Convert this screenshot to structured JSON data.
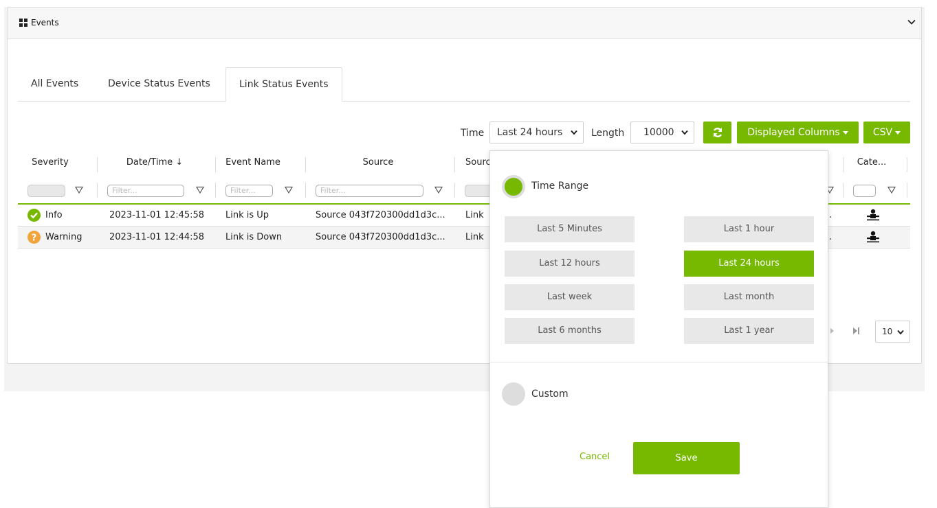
{
  "panel": {
    "title": "Events"
  },
  "tabs": [
    {
      "label": "All Events"
    },
    {
      "label": "Device Status Events"
    },
    {
      "label": "Link Status Events"
    }
  ],
  "toolbar": {
    "time_label": "Time",
    "time_value": "Last 24 hours",
    "length_label": "Length",
    "length_value": "10000",
    "displayed_columns_label": "Displayed Columns",
    "csv_label": "CSV"
  },
  "table": {
    "columns": [
      "Severity",
      "Date/Time ↓",
      "Event Name",
      "Source",
      "Sourc",
      "Cate..."
    ],
    "filter_placeholder": "Filter...",
    "rows": [
      {
        "severity": "Info",
        "datetime": "2023-11-01 12:45:58",
        "event_name": "Link is Up",
        "source": "Source 043f720300dd1d3c...",
        "source2": "Link",
        "trunc": "."
      },
      {
        "severity": "Warning",
        "datetime": "2023-11-01 12:44:58",
        "event_name": "Link is Down",
        "source": "Source 043f720300dd1d3c...",
        "source2": "Link",
        "trunc": "."
      }
    ],
    "page_size": "10"
  },
  "popup": {
    "time_range_label": "Time Range",
    "ranges": [
      {
        "label": "Last 5 Minutes"
      },
      {
        "label": "Last 1 hour"
      },
      {
        "label": "Last 12 hours"
      },
      {
        "label": "Last 24 hours"
      },
      {
        "label": "Last week"
      },
      {
        "label": "Last month"
      },
      {
        "label": "Last 6 months"
      },
      {
        "label": "Last 1 year"
      }
    ],
    "selected_range": "Last 24 hours",
    "custom_label": "Custom",
    "cancel_label": "Cancel",
    "save_label": "Save"
  },
  "colors": {
    "accent": "#76b900",
    "info": "#76b900",
    "warning": "#f0a43a"
  }
}
